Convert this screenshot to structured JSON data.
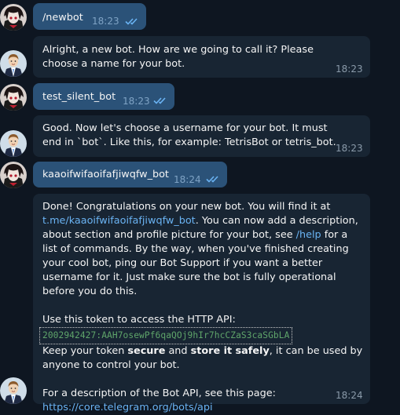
{
  "colors": {
    "background": "#0e1621",
    "outgoing_bubble": "#2b5278",
    "incoming_bubble": "#182533",
    "link": "#6ab3f3",
    "token": "#5fa56a"
  },
  "messages": [
    {
      "sender": "user",
      "text": "/newbot",
      "time": "18:23",
      "status": "read-double-check-icon"
    },
    {
      "sender": "bot",
      "text": "Alright, a new bot. How are we going to call it? Please choose a name for your bot.",
      "time": "18:23"
    },
    {
      "sender": "user",
      "text": "test_silent_bot",
      "time": "18:23",
      "status": "read-double-check-icon"
    },
    {
      "sender": "bot",
      "text": "Good. Now let's choose a username for your bot. It must end in `bot`. Like this, for example: TetrisBot or tetris_bot.",
      "time": "18:23"
    },
    {
      "sender": "user",
      "text": "kaaoifwifaoifafjiwqfw_bot",
      "time": "18:24",
      "status": "read-double-check-icon"
    },
    {
      "sender": "bot",
      "time": "18:24",
      "p1_a": "Done! Congratulations on your new bot. You will find it at",
      "p1_link": "t.me/kaaoifwifaoifafjiwqfw_bot",
      "p1_b": ". You can now add a description, about section and profile picture for your bot, see",
      "p1_help": "/help",
      "p1_c": "for a list of commands. By the way, when you've finished creating your cool bot, ping our Bot Support if you want a better username for it. Just make sure the bot is fully operational before you do this.",
      "p2_label": "Use this token to access the HTTP API:",
      "token": "2002942427:AAH7osewPf6qaQOj9hIr7hcCZaS3caSGbLA",
      "p3_a": "Keep your token",
      "p3_b1": "secure",
      "p3_c": "and",
      "p3_b2": "store it safely",
      "p3_d": ", it can be used by anyone to control your bot.",
      "p4_label": "For a description of the Bot API, see this page:",
      "p4_link": "https://core.telegram.org/bots/api"
    }
  ]
}
